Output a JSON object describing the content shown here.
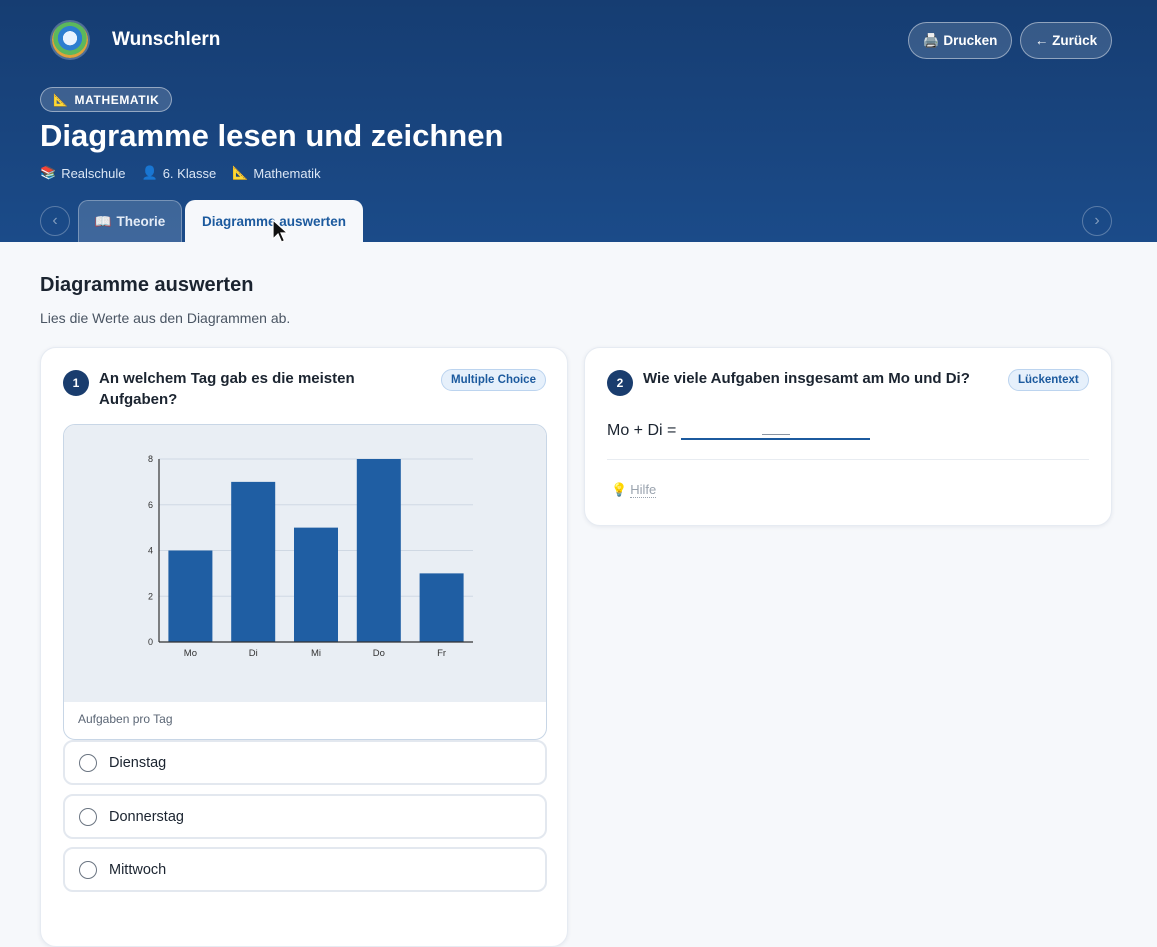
{
  "app": {
    "brand": "Wunschlern"
  },
  "header": {
    "print_label": "Drucken",
    "back_label": "← Zurück",
    "subject_pill": "MATHEMATIK",
    "title": "Diagramme lesen und zeichnen",
    "meta": [
      {
        "icon": "books-icon",
        "glyph": "📚",
        "label": "Realschule"
      },
      {
        "icon": "user-icon",
        "glyph": "👤",
        "label": "6. Klasse"
      },
      {
        "icon": "ruler-icon",
        "glyph": "📐",
        "label": "Mathematik"
      }
    ],
    "tabs": [
      {
        "glyph": "📖",
        "label": "Theorie",
        "active": false
      },
      {
        "glyph": "",
        "label": "Diagramme auswerten",
        "active": true
      }
    ],
    "tab_prev": "‹",
    "tab_next": "›"
  },
  "section": {
    "title": "Diagramme auswerten",
    "subtitle": "Lies die Werte aus den Diagrammen ab."
  },
  "questions": [
    {
      "number": "1",
      "text": "An welchem Tag gab es die meisten Aufgaben?",
      "type": "Multiple Choice",
      "chart_caption": "Aufgaben pro Tag",
      "options": [
        "Dienstag",
        "Donnerstag",
        "Mittwoch"
      ]
    },
    {
      "number": "2",
      "text": "Wie viele Aufgaben insgesamt am Mo und Di?",
      "type": "Lückentext",
      "prompt": "Mo + Di =",
      "answer_value": "",
      "hint_label": "Hilfe",
      "hint_glyph": "💡"
    }
  ],
  "colors": {
    "accent": "#1c5a9e",
    "bar": "#1f5ea3",
    "header": "#163d72"
  },
  "chart_data": {
    "type": "bar",
    "categories": [
      "Mo",
      "Di",
      "Mi",
      "Do",
      "Fr"
    ],
    "values": [
      4,
      7,
      5,
      8,
      3
    ],
    "ylim": [
      0,
      8
    ],
    "yticks": [
      0,
      2,
      4,
      6,
      8
    ],
    "grid": true,
    "title": "",
    "xlabel": "",
    "ylabel": ""
  }
}
